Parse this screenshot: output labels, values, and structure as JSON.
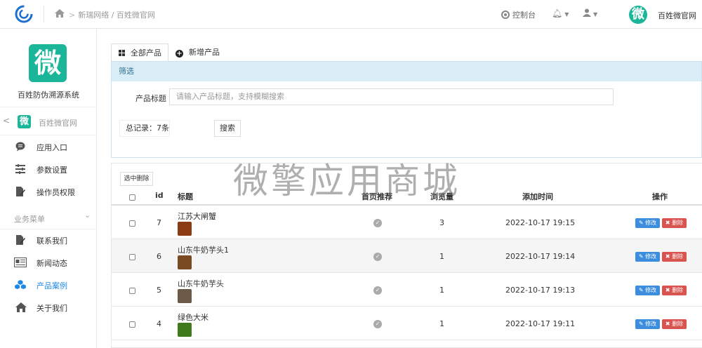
{
  "header": {
    "breadcrumb": "新瑞网络 / 百姓微官网",
    "control_panel": "控制台",
    "user_name": "百姓微官网",
    "avatar_char": "微"
  },
  "sidebar": {
    "logo_char": "微",
    "system_name": "百姓防伪溯源系统",
    "site_name": "百姓微官网",
    "site_char": "微",
    "items_top": [
      {
        "label": "应用入口",
        "icon": "chat-bubble-icon"
      },
      {
        "label": "参数设置",
        "icon": "sliders-icon"
      },
      {
        "label": "操作员权限",
        "icon": "doc-edit-icon"
      }
    ],
    "group_title": "业务菜单",
    "items_business": [
      {
        "label": "联系我们",
        "icon": "doc-edit-icon"
      },
      {
        "label": "新闻动态",
        "icon": "newspaper-icon"
      },
      {
        "label": "产品案例",
        "icon": "cubes-icon",
        "active": true
      },
      {
        "label": "关于我们",
        "icon": "home-icon"
      }
    ]
  },
  "tabs": [
    "全部产品",
    "新增产品"
  ],
  "filter": {
    "header": "筛选",
    "title_label": "产品标题",
    "title_placeholder": "请输入产品标题，支持模糊搜索",
    "total": "总记录：7条",
    "search_button": "搜索"
  },
  "table": {
    "delete_selected": "选中删除",
    "columns": [
      "id",
      "标题",
      "首页推荐",
      "浏览量",
      "添加时间",
      "操作"
    ],
    "edit_label": "修改",
    "delete_label": "删除",
    "rows": [
      {
        "id": "7",
        "title": "江苏大闸蟹",
        "views": "3",
        "time": "2022-10-17 19:15",
        "thumb_color": "#8a3b12"
      },
      {
        "id": "6",
        "title": "山东牛奶芋头1",
        "views": "1",
        "time": "2022-10-17 19:14",
        "thumb_color": "#7a4a22"
      },
      {
        "id": "5",
        "title": "山东牛奶芋头",
        "views": "1",
        "time": "2022-10-17 19:13",
        "thumb_color": "#6b5a48"
      },
      {
        "id": "4",
        "title": "绿色大米",
        "views": "1",
        "time": "2022-10-17 19:11",
        "thumb_color": "#3f7a1c"
      }
    ]
  },
  "watermark": "微擎应用商城",
  "colors": {
    "brand": "#1bb59a",
    "accent": "#1e88e5",
    "edit": "#3c8dde",
    "delete": "#d9534f",
    "filter_header_bg": "#d9edf7"
  }
}
